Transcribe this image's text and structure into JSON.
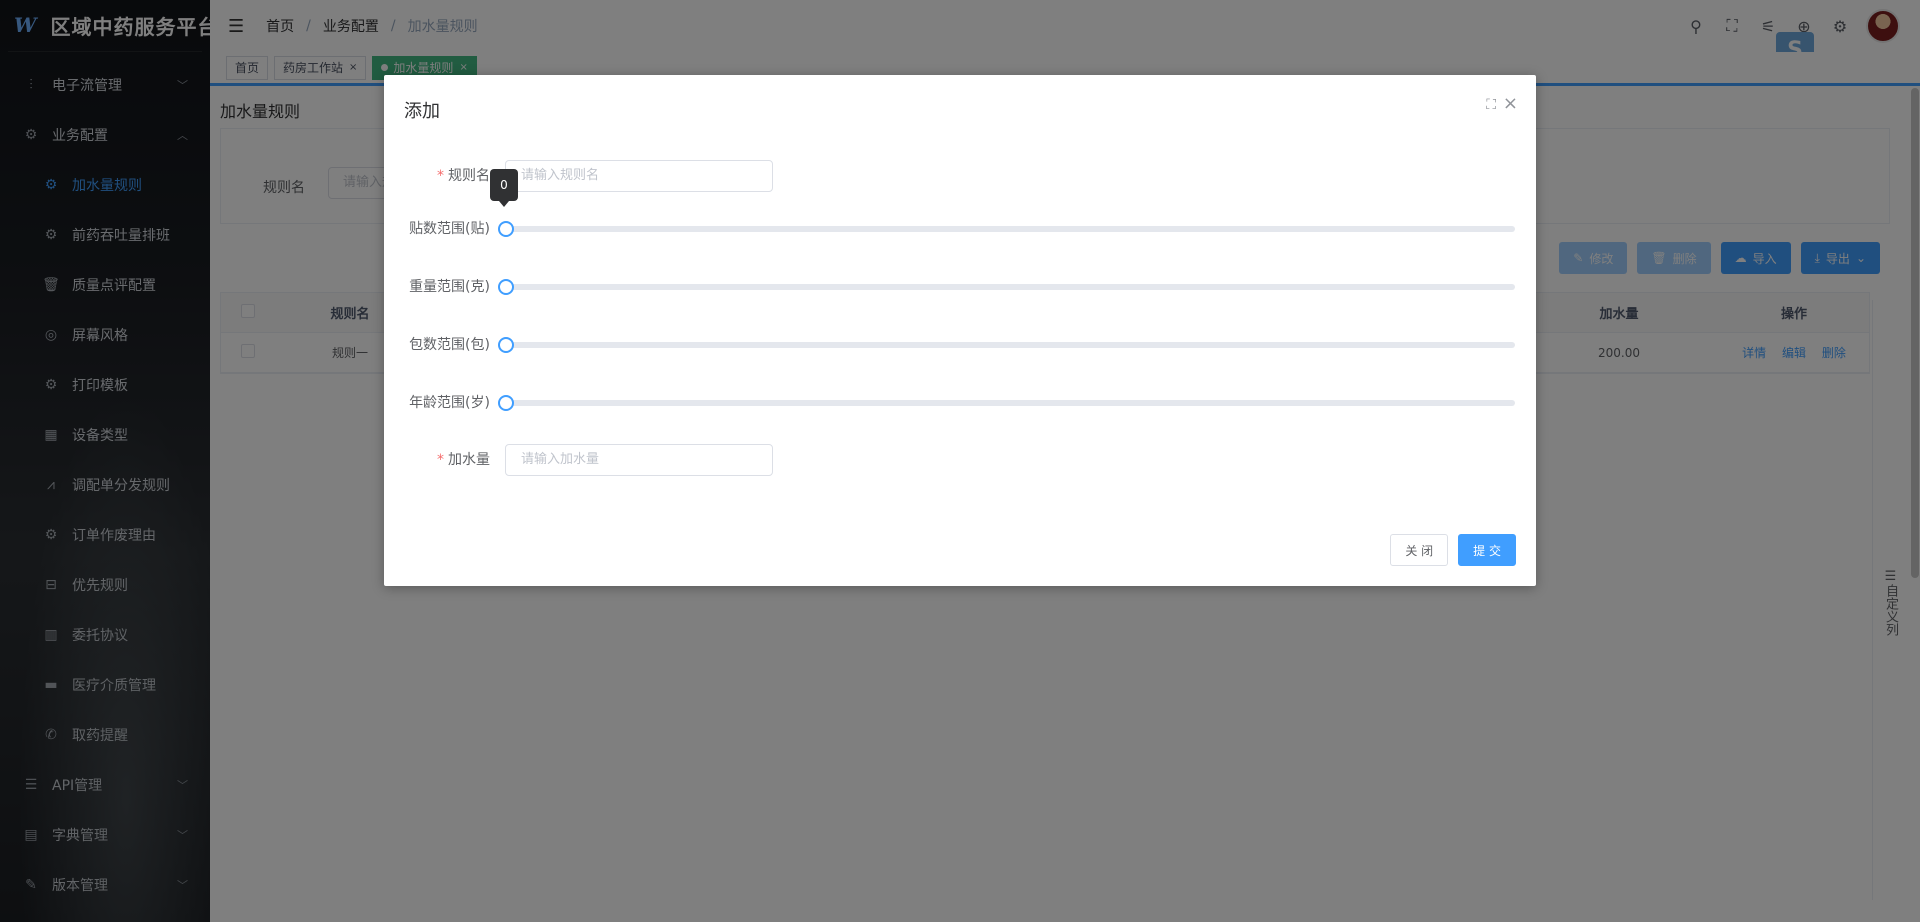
{
  "app": {
    "title": "区域中药服务平台",
    "logo_glyph": "W"
  },
  "sidebar": {
    "items": [
      {
        "label": "电子流管理",
        "icon": "sliders-icon",
        "glyph": "⫶",
        "expanded": false
      },
      {
        "label": "业务配置",
        "icon": "gear-icon",
        "glyph": "⚙",
        "expanded": true
      }
    ],
    "sub_items": [
      {
        "label": "加水量规则",
        "icon": "gear-icon",
        "glyph": "⚙",
        "active": true
      },
      {
        "label": "前药吞吐量排班",
        "icon": "gear-icon",
        "glyph": "⚙"
      },
      {
        "label": "质量点评配置",
        "icon": "trash-icon",
        "glyph": "🗑"
      },
      {
        "label": "屏幕风格",
        "icon": "palette-icon",
        "glyph": "◎"
      },
      {
        "label": "打印模板",
        "icon": "gear-icon",
        "glyph": "⚙"
      },
      {
        "label": "设备类型",
        "icon": "grid-icon",
        "glyph": "▦"
      },
      {
        "label": "调配单分发规则",
        "icon": "chart-line-icon",
        "glyph": "⩘"
      },
      {
        "label": "订单作废理由",
        "icon": "gear-icon",
        "glyph": "⚙"
      },
      {
        "label": "优先规则",
        "icon": "inbox-icon",
        "glyph": "⊟"
      },
      {
        "label": "委托协议",
        "icon": "bar-chart-icon",
        "glyph": "▥"
      },
      {
        "label": "医疗介质管理",
        "icon": "stamp-icon",
        "glyph": "▬"
      },
      {
        "label": "取药提醒",
        "icon": "phone-icon",
        "glyph": "✆"
      }
    ],
    "bottom_items": [
      {
        "label": "API管理",
        "icon": "sliders-h-icon",
        "glyph": "☰"
      },
      {
        "label": "字典管理",
        "icon": "book-icon",
        "glyph": "▤"
      },
      {
        "label": "版本管理",
        "icon": "edit-icon",
        "glyph": "✎"
      }
    ]
  },
  "header": {
    "menu_glyph": "☰",
    "breadcrumb": [
      "首页",
      "业务配置",
      "加水量规则"
    ],
    "separator": "/",
    "icons": [
      {
        "name": "search-icon",
        "glyph": "⚲"
      },
      {
        "name": "fullscreen-icon",
        "glyph": "⛶"
      },
      {
        "name": "size-icon",
        "glyph": "⚟"
      },
      {
        "name": "language-icon",
        "glyph": "⊕"
      },
      {
        "name": "settings-icon",
        "glyph": "⚙"
      }
    ],
    "badge_glyph": "S"
  },
  "tags": [
    {
      "label": "首页",
      "closable": false,
      "active": false
    },
    {
      "label": "药房工作站",
      "closable": true,
      "active": false
    },
    {
      "label": "加水量规则",
      "closable": true,
      "active": true
    }
  ],
  "tag_close_glyph": "×",
  "main": {
    "page_title": "加水量规则",
    "search": {
      "label": "规则名",
      "placeholder": "请输入规则名"
    },
    "toolbar": [
      {
        "label": "修改",
        "glyph": "✎",
        "style": "light"
      },
      {
        "label": "删除",
        "glyph": "🗑",
        "style": "light"
      },
      {
        "label": "导入",
        "glyph": "☁",
        "style": "primary"
      },
      {
        "label": "导出",
        "glyph": "⤓",
        "style": "primary",
        "dropdown": "⌄"
      }
    ],
    "table": {
      "headers": [
        "规则名",
        "加水量",
        "操作"
      ],
      "rows": [
        {
          "name": "规则一",
          "water": "200.00",
          "ops": [
            "详情",
            "编辑",
            "删除"
          ]
        }
      ]
    },
    "custom_columns": "☰自定义列"
  },
  "dialog": {
    "title": "添加",
    "fullscreen_glyph": "⛶",
    "close_glyph": "×",
    "fields": {
      "rule_name": {
        "label": "规则名",
        "placeholder": "请输入规则名",
        "required": true
      },
      "dose_range": {
        "label": "贴数范围(贴)",
        "value": 0,
        "tooltip": "0"
      },
      "weight_range": {
        "label": "重量范围(克)",
        "value": 0
      },
      "pack_range": {
        "label": "包数范围(包)",
        "value": 0
      },
      "age_range": {
        "label": "年龄范围(岁)",
        "value": 0
      },
      "water": {
        "label": "加水量",
        "placeholder": "请输入加水量",
        "required": true
      }
    },
    "required_mark": "*",
    "buttons": {
      "close": "关 闭",
      "submit": "提 交"
    }
  }
}
